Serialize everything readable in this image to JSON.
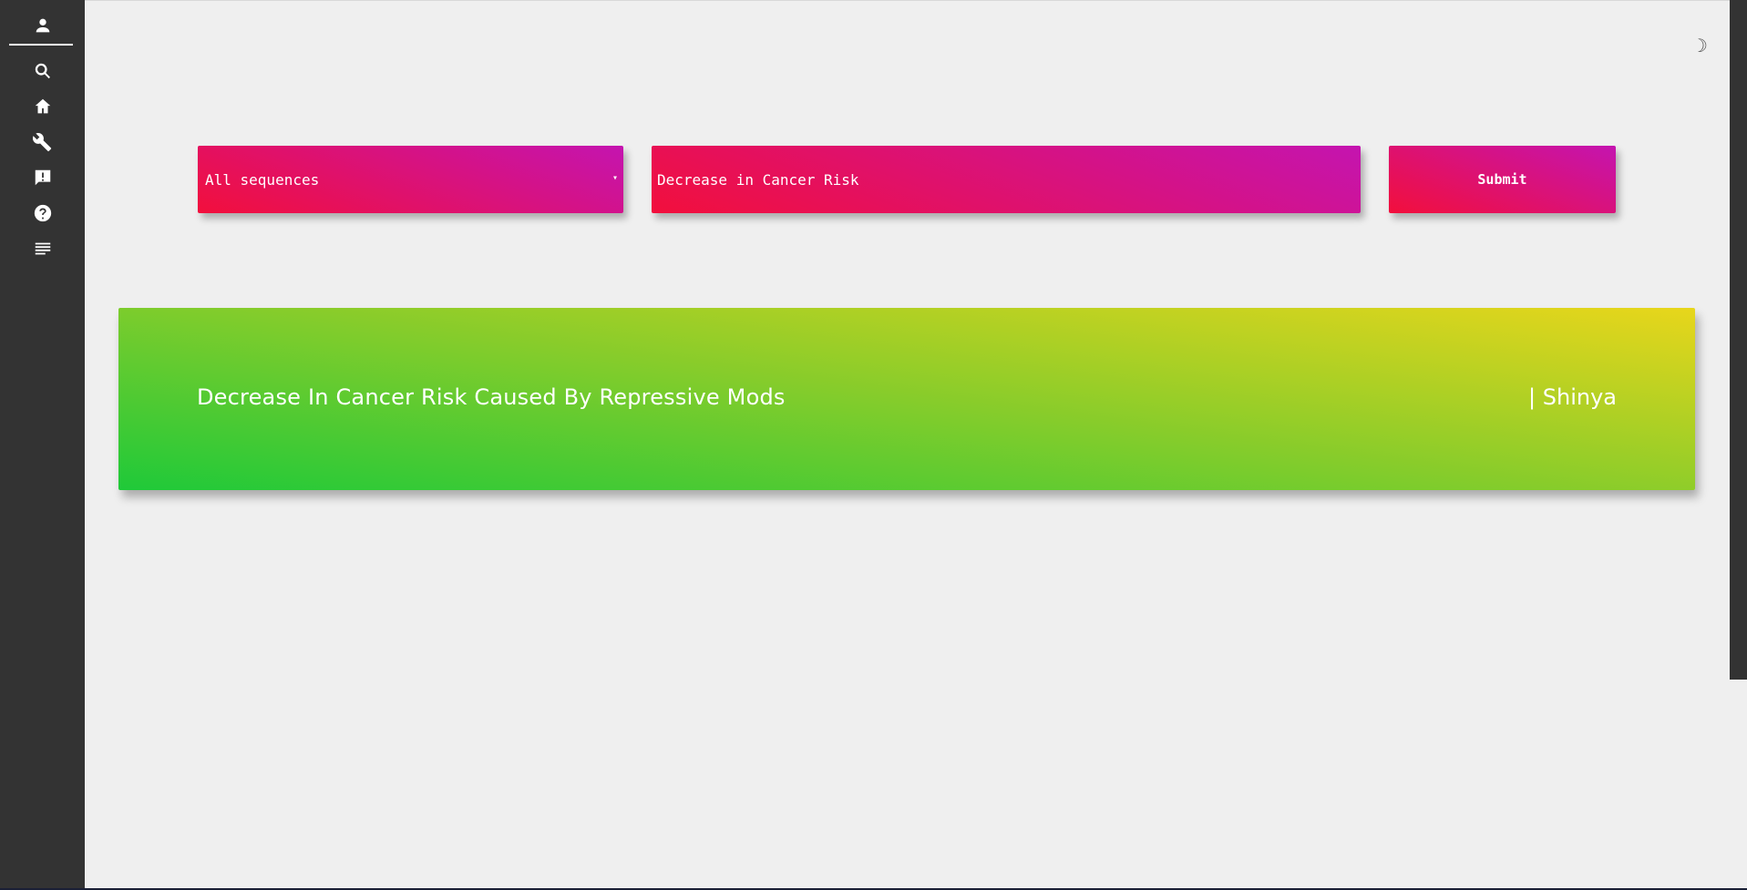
{
  "sidebar": {
    "items": [
      {
        "icon": "person-icon"
      },
      {
        "icon": "search-icon"
      },
      {
        "icon": "home-icon"
      },
      {
        "icon": "wrench-icon"
      },
      {
        "icon": "feedback-icon"
      },
      {
        "icon": "help-icon"
      },
      {
        "icon": "notes-icon"
      }
    ]
  },
  "header": {
    "theme_toggle": "☽"
  },
  "search": {
    "category_value": "All sequences",
    "category_caret": "▾",
    "query_value": "Decrease in Cancer Risk",
    "submit_label": "Submit"
  },
  "results": [
    {
      "title": "Decrease In Cancer Risk Caused By Repressive Mods",
      "author": "| Shinya"
    }
  ],
  "colors": {
    "sidebar": "#333333",
    "background": "#efefef",
    "control_gradient_start": "#f20f3c",
    "control_gradient_end": "#c414b0",
    "card_gradient_start": "#1fc939",
    "card_gradient_end": "#e8d61b"
  }
}
